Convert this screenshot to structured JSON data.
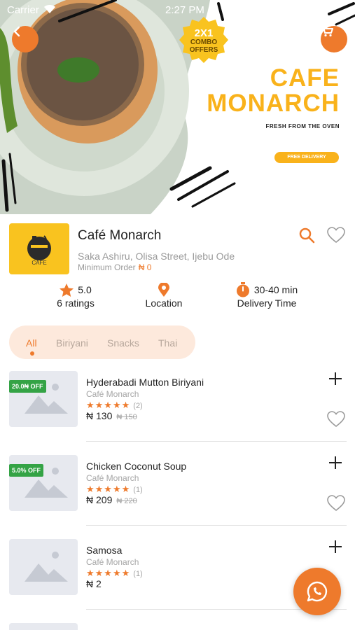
{
  "status_bar": {
    "carrier": "Carrier",
    "time": "2:27 PM"
  },
  "banner": {
    "combo_line1": "2X1",
    "combo_line2": "COMBO",
    "combo_line3": "OFFERS",
    "brand_line1": "CAFE",
    "brand_line2": "MONARCH",
    "tagline": "FRESH FROM THE OVEN",
    "free_delivery": "FREE DELIVERY"
  },
  "restaurant": {
    "logo_text": "CAFE",
    "name": "Café Monarch",
    "address": "Saka Ashiru, Olisa Street, Ijebu Ode",
    "min_order_label": "Minimum Order",
    "min_order_value": "₦ 0",
    "rating": "5.0",
    "rating_count": "6 ratings",
    "location_label": "Location",
    "delivery_time": "30-40 min",
    "delivery_label": "Delivery Time"
  },
  "tabs": [
    "All",
    "Biriyani",
    "Snacks",
    "Thai"
  ],
  "items": [
    {
      "name": "Hyderabadi Mutton Biriyani",
      "restaurant": "Café Monarch",
      "stars": "★★★★★",
      "reviews": "(2)",
      "price": "₦ 130",
      "old_price": "₦ 150",
      "badge": "20.0₦ OFF"
    },
    {
      "name": "Chicken Coconut Soup",
      "restaurant": "Café Monarch",
      "stars": "★★★★★",
      "reviews": "(1)",
      "price": "₦ 209",
      "old_price": "₦ 220",
      "badge": "5.0% OFF"
    },
    {
      "name": "Samosa",
      "restaurant": "Café Monarch",
      "stars": "★★★★★",
      "reviews": "(1)",
      "price": "₦ 2",
      "old_price": "",
      "badge": ""
    }
  ],
  "colors": {
    "accent": "#ee7a2c",
    "brand_yellow": "#f9b21b",
    "discount_green": "#34a345"
  }
}
